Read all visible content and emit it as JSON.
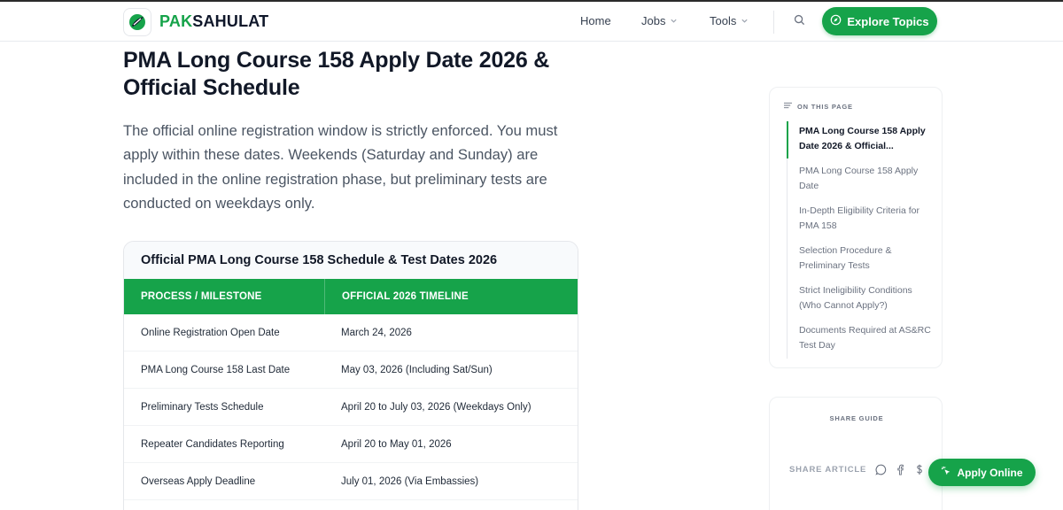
{
  "brand": {
    "name_part1": "PAK",
    "name_part2": "SAHULAT"
  },
  "nav": {
    "home": "Home",
    "jobs": "Jobs",
    "tools": "Tools",
    "explore_label": "Explore Topics"
  },
  "article": {
    "title": "PMA Long Course 158 Apply Date 2026 & Official Schedule",
    "intro": "The official online registration window is strictly enforced. You must apply within these dates. Weekends (Saturday and Sunday) are included in the online registration phase, but preliminary tests are conducted on weekdays only."
  },
  "table": {
    "caption": "Official PMA Long Course 158 Schedule & Test Dates 2026",
    "headers": [
      "PROCESS / MILESTONE",
      "OFFICIAL 2026 TIMELINE"
    ],
    "rows": [
      {
        "process": "Online Registration Open Date",
        "timeline": "March 24, 2026"
      },
      {
        "process": "PMA Long Course 158 Last Date",
        "timeline": "May 03, 2026 (Including Sat/Sun)"
      },
      {
        "process": "Preliminary Tests Schedule",
        "timeline": "April 20 to July 03, 2026 (Weekdays Only)"
      },
      {
        "process": "Repeater Candidates Reporting",
        "timeline": "April 20 to May 01, 2026"
      },
      {
        "process": "Overseas Apply Deadline",
        "timeline": "July 01, 2026 (Via Embassies)"
      }
    ]
  },
  "toc": {
    "heading": "ON THIS PAGE",
    "items": [
      {
        "label": "PMA Long Course 158 Apply Date 2026 & Official..."
      },
      {
        "label": "PMA Long Course 158 Apply Date"
      },
      {
        "label": "In-Depth Eligibility Criteria for PMA 158"
      },
      {
        "label": "Selection Procedure & Preliminary Tests"
      },
      {
        "label": "Strict Ineligibility Conditions (Who Cannot Apply?)"
      },
      {
        "label": "Documents Required at AS&RC Test Day"
      }
    ]
  },
  "share": {
    "guide_label": "SHARE GUIDE",
    "article_label": "SHARE ARTICLE",
    "icons": [
      "whatsapp-icon",
      "facebook-icon",
      "dollar-icon"
    ]
  },
  "apply_button": {
    "label": "Apply Online"
  },
  "colors": {
    "brand_green": "#16a34a",
    "text_dark": "#111827",
    "text_muted": "#6b7280"
  }
}
